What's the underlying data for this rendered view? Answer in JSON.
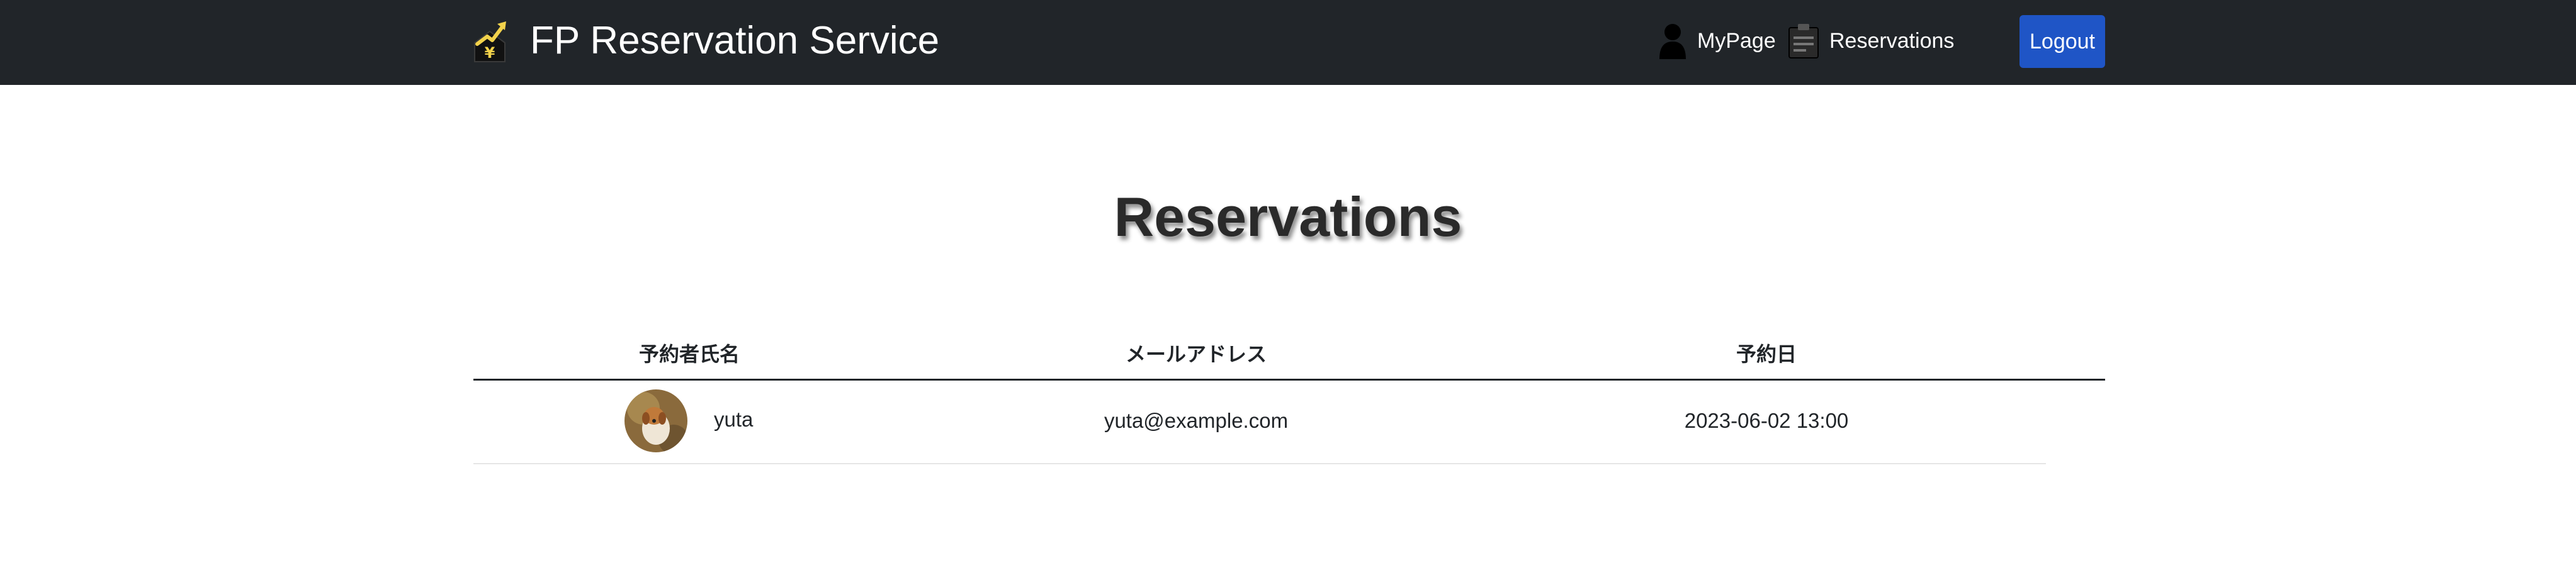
{
  "app": {
    "title": "FP Reservation Service",
    "logo_icon": "yen-growth-house-icon"
  },
  "nav": {
    "mypage": {
      "label": "MyPage",
      "icon": "user-icon"
    },
    "reservations": {
      "label": "Reservations",
      "icon": "reservation-board-icon"
    },
    "logout": {
      "label": "Logout"
    }
  },
  "page": {
    "title": "Reservations"
  },
  "table": {
    "columns": [
      "予約者氏名",
      "メールアドレス",
      "予約日"
    ],
    "rows": [
      {
        "name": "yuta",
        "email": "yuta@example.com",
        "date": "2023-06-02 13:00",
        "avatar": "user-photo-dog"
      }
    ]
  },
  "colors": {
    "navbar": "#212529",
    "button": "#1f55c6",
    "logo_accent": "#f2d24b"
  }
}
